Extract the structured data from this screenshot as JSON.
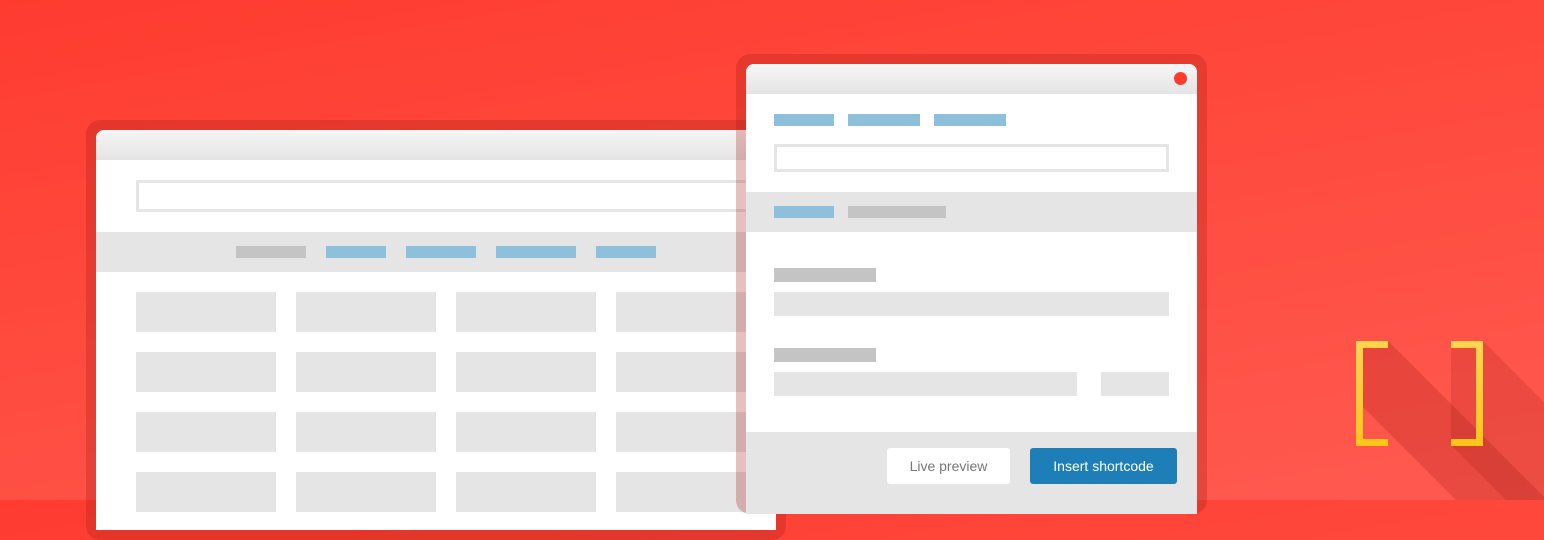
{
  "illustration": {
    "background_color": "#ff3b30",
    "bracket_color": "#fdc72f",
    "accent_blue": "#8ebfdb",
    "close_dot_color": "#ff3b30"
  },
  "back_window": {
    "nav_tabs": [
      "tab-1",
      "tab-2",
      "tab-3",
      "tab-4",
      "tab-5"
    ],
    "grid_rows": 4,
    "grid_cols": 4
  },
  "dialog": {
    "tabs": [
      "tab-1",
      "tab-2",
      "tab-3"
    ],
    "subtabs": [
      "subtab-1",
      "subtab-2"
    ],
    "buttons": {
      "live_preview": "Live preview",
      "insert_shortcode": "Insert shortcode"
    },
    "button_colors": {
      "primary": "#1e7fb8",
      "secondary": "#ffffff"
    }
  },
  "logo": {
    "icon": "square-brackets-icon"
  }
}
